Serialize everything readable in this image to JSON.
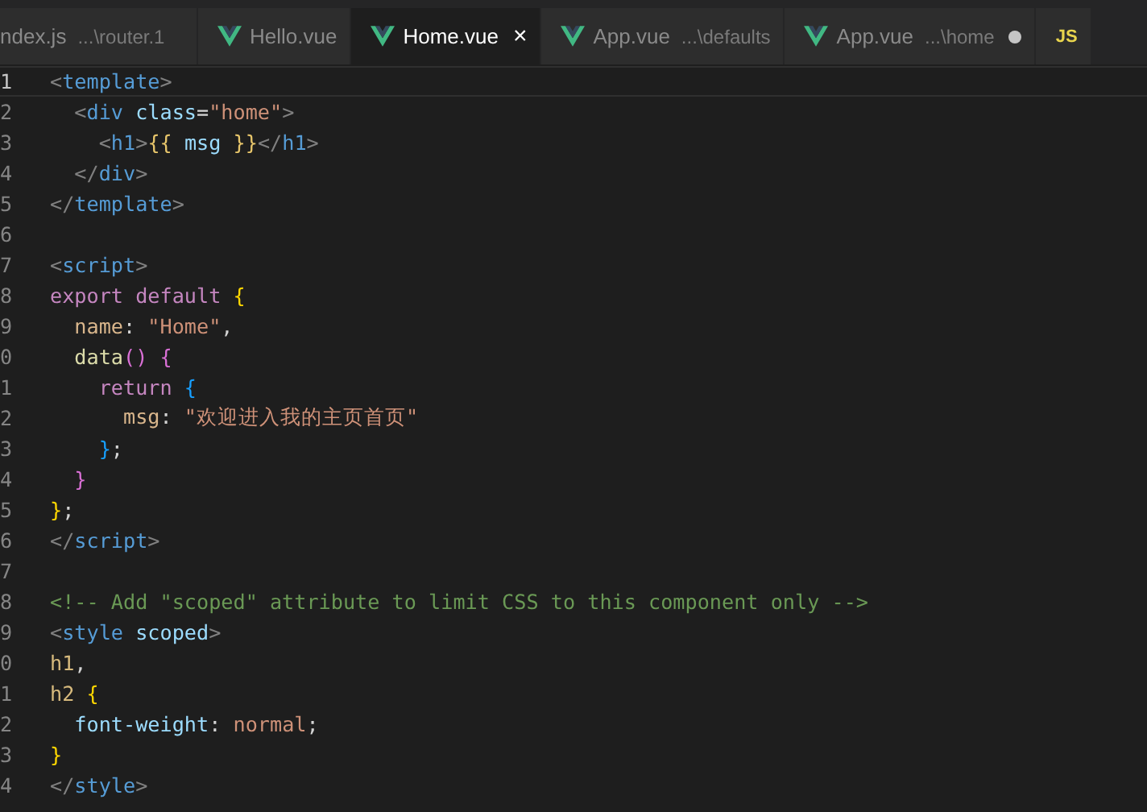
{
  "tabs": [
    {
      "kind": "js",
      "label": "ndex.js",
      "description": "...\\router.1",
      "selected": false,
      "modified": false
    },
    {
      "kind": "vue",
      "label": "Hello.vue",
      "selected": false,
      "modified": false
    },
    {
      "kind": "vue",
      "label": "Home.vue",
      "selected": true,
      "modified": false,
      "close": "×"
    },
    {
      "kind": "vue",
      "label": "App.vue",
      "description": "...\\defaults",
      "selected": false,
      "modified": false
    },
    {
      "kind": "vue",
      "label": "App.vue",
      "description": "...\\home",
      "selected": false,
      "modified": true
    },
    {
      "kind": "js",
      "icon_text": "JS",
      "selected": false,
      "modified": false
    }
  ],
  "editor": {
    "lines": [
      {
        "number": "1",
        "current": true,
        "tokens": [
          {
            "kind": "punct",
            "text": "<"
          },
          {
            "kind": "tag",
            "text": "template"
          },
          {
            "kind": "punct",
            "text": ">"
          }
        ]
      },
      {
        "number": "2",
        "current": false,
        "tokens": [
          {
            "kind": "punct",
            "text": "  <"
          },
          {
            "kind": "tag",
            "text": "div"
          },
          {
            "kind": "attr",
            "text": " class"
          },
          {
            "kind": "plain",
            "text": "="
          },
          {
            "kind": "string",
            "text": "\"home\""
          },
          {
            "kind": "punct",
            "text": ">"
          }
        ]
      },
      {
        "number": "3",
        "current": false,
        "tokens": [
          {
            "kind": "punct",
            "text": "    <"
          },
          {
            "kind": "tag",
            "text": "h1"
          },
          {
            "kind": "punct",
            "text": ">"
          },
          {
            "kind": "interp",
            "text": "{{"
          },
          {
            "kind": "attr",
            "text": " msg "
          },
          {
            "kind": "interp",
            "text": "}}"
          },
          {
            "kind": "punct",
            "text": "</"
          },
          {
            "kind": "tag",
            "text": "h1"
          },
          {
            "kind": "punct",
            "text": ">"
          }
        ]
      },
      {
        "number": "4",
        "current": false,
        "tokens": [
          {
            "kind": "punct",
            "text": "  </"
          },
          {
            "kind": "tag",
            "text": "div"
          },
          {
            "kind": "punct",
            "text": ">"
          }
        ]
      },
      {
        "number": "5",
        "current": false,
        "tokens": [
          {
            "kind": "punct",
            "text": "</"
          },
          {
            "kind": "tag",
            "text": "template"
          },
          {
            "kind": "punct",
            "text": ">"
          }
        ]
      },
      {
        "number": "6",
        "current": false
      },
      {
        "number": "7",
        "current": false,
        "tokens": [
          {
            "kind": "punct",
            "text": "<"
          },
          {
            "kind": "tag",
            "text": "script"
          },
          {
            "kind": "punct",
            "text": ">"
          }
        ]
      },
      {
        "number": "8",
        "current": false,
        "tokens": [
          {
            "kind": "keyword",
            "text": "export default"
          },
          {
            "kind": "bracket1",
            "text": " {"
          }
        ]
      },
      {
        "number": "9",
        "current": false,
        "tokens": [
          {
            "kind": "prop",
            "text": "  name"
          },
          {
            "kind": "plain",
            "text": ":"
          },
          {
            "kind": "string",
            "text": " \"Home\""
          },
          {
            "kind": "plain",
            "text": ","
          }
        ]
      },
      {
        "number": "0",
        "current": false,
        "tokens": [
          {
            "kind": "func",
            "text": "  data"
          },
          {
            "kind": "bracket2",
            "text": "() {"
          }
        ]
      },
      {
        "number": "1",
        "current": false,
        "tokens": [
          {
            "kind": "keyword",
            "text": "    return"
          },
          {
            "kind": "bracket3",
            "text": " {"
          }
        ]
      },
      {
        "number": "2",
        "current": false,
        "tokens": [
          {
            "kind": "prop",
            "text": "      msg"
          },
          {
            "kind": "plain",
            "text": ":"
          },
          {
            "kind": "string",
            "text": " \"欢迎进入我的主页首页\""
          }
        ]
      },
      {
        "number": "3",
        "current": false,
        "tokens": [
          {
            "kind": "bracket3",
            "text": "    }"
          },
          {
            "kind": "plain",
            "text": ";"
          }
        ]
      },
      {
        "number": "4",
        "current": false,
        "tokens": [
          {
            "kind": "bracket2",
            "text": "  }"
          }
        ]
      },
      {
        "number": "5",
        "current": false,
        "tokens": [
          {
            "kind": "bracket1",
            "text": "}"
          },
          {
            "kind": "plain",
            "text": ";"
          }
        ]
      },
      {
        "number": "6",
        "current": false,
        "tokens": [
          {
            "kind": "punct",
            "text": "</"
          },
          {
            "kind": "tag",
            "text": "script"
          },
          {
            "kind": "punct",
            "text": ">"
          }
        ]
      },
      {
        "number": "7",
        "current": false
      },
      {
        "number": "8",
        "current": false,
        "tokens": [
          {
            "kind": "comment",
            "text": "<!-- Add \"scoped\" attribute to limit CSS to this component only -->"
          }
        ]
      },
      {
        "number": "9",
        "current": false,
        "tokens": [
          {
            "kind": "punct",
            "text": "<"
          },
          {
            "kind": "tag",
            "text": "style"
          },
          {
            "kind": "attr",
            "text": " scoped"
          },
          {
            "kind": "punct",
            "text": ">"
          }
        ]
      },
      {
        "number": "0",
        "current": false,
        "tokens": [
          {
            "kind": "selector",
            "text": "h1"
          },
          {
            "kind": "plain",
            "text": ","
          }
        ]
      },
      {
        "number": "1",
        "current": false,
        "tokens": [
          {
            "kind": "selector",
            "text": "h2"
          },
          {
            "kind": "bracket1",
            "text": " {"
          }
        ]
      },
      {
        "number": "2",
        "current": false,
        "tokens": [
          {
            "kind": "attr",
            "text": "  font-weight"
          },
          {
            "kind": "plain",
            "text": ":"
          },
          {
            "kind": "string",
            "text": " normal"
          },
          {
            "kind": "plain",
            "text": ";"
          }
        ]
      },
      {
        "number": "3",
        "current": false,
        "tokens": [
          {
            "kind": "bracket1",
            "text": "}"
          }
        ]
      },
      {
        "number": "4",
        "current": false,
        "tokens": [
          {
            "kind": "punct",
            "text": "</"
          },
          {
            "kind": "tag",
            "text": "style"
          },
          {
            "kind": "punct",
            "text": ">"
          }
        ]
      }
    ]
  }
}
